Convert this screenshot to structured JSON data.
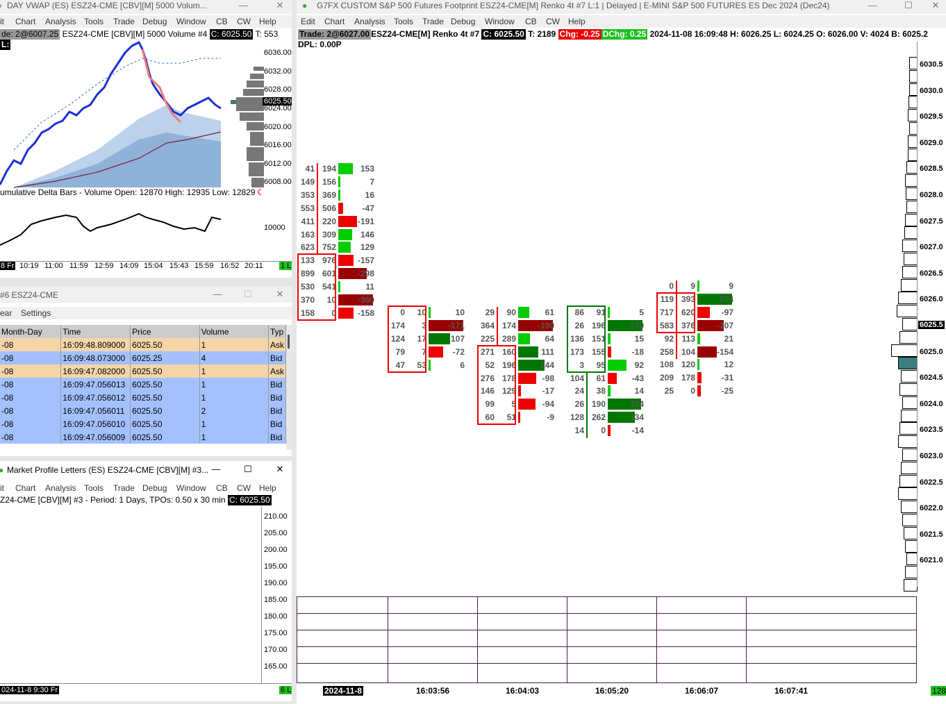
{
  "win1": {
    "title": "DAY VWAP (ES) ESZ24-CME [CBV][M]  5000 Volum...",
    "menu": [
      "it",
      "Chart",
      "Analysis",
      "Tools",
      "Trade",
      "Debug",
      "Window",
      "CB",
      "CW",
      "Help"
    ],
    "info_line1": "de: 2@6007.25",
    "info_sym": "ESZ24-CME [CBV][M]  5000 Volume #4",
    "info_close": "C: 6025.50",
    "info_t": "T: 553",
    "info_line2": "L:",
    "price_labels": [
      "6036.00",
      "6032.00",
      "6028.00",
      "6024.00",
      "6020.00",
      "6016.00",
      "6012.00",
      "6008.00"
    ],
    "price_current": "6025.50",
    "delta_title": "umulative Delta Bars - Volume  Open: 12870  High: 12935  Low: 12829",
    "delta_title_tail": "Cl",
    "delta_scale": "10000",
    "time_labels": [
      "10:19",
      "11:00",
      "11:59",
      "12:59",
      "14:09",
      "15:04",
      "15:43",
      "15:59",
      "16:52",
      "20:11"
    ],
    "time_first": "8 Fr",
    "bottom_badge": "1 L"
  },
  "win2": {
    "title": "#6 ESZ24-CME",
    "menu": [
      "ear",
      "Settings"
    ],
    "headers": [
      "Month-Day",
      "Time",
      "Price",
      "Volume",
      "Typ"
    ],
    "rows": [
      [
        "-08",
        "16:09:48.809000",
        "6025.50",
        "1",
        "Ask"
      ],
      [
        "-08",
        "16:09:48.073000",
        "6025.25",
        "4",
        "Bid"
      ],
      [
        "-08",
        "16:09:47.082000",
        "6025.50",
        "1",
        "Ask"
      ],
      [
        "-08",
        "16:09:47.056013",
        "6025.50",
        "1",
        "Bid"
      ],
      [
        "-08",
        "16:09:47.056012",
        "6025.50",
        "1",
        "Bid"
      ],
      [
        "-08",
        "16:09:47.056011",
        "6025.50",
        "2",
        "Bid"
      ],
      [
        "-08",
        "16:09:47.056010",
        "6025.50",
        "1",
        "Bid"
      ],
      [
        "-08",
        "16:09:47.056009",
        "6025.50",
        "1",
        "Bid"
      ]
    ]
  },
  "win3": {
    "title": "Market Profile Letters (ES) ESZ24-CME [CBV][M] #3...",
    "menu": [
      "it",
      "Chart",
      "Analysis",
      "Tools",
      "Trade",
      "Debug",
      "Window",
      "CB",
      "CW",
      "Help"
    ],
    "info": "Z24-CME [CBV][M] #3 - Period: 1 Days, TPOs: 0.50 x 30 min",
    "info_close": "C: 6025.50",
    "scale": [
      "210.00",
      "205.00",
      "200.00",
      "195.00",
      "190.00",
      "185.00",
      "180.00",
      "175.00",
      "170.00",
      "165.00"
    ],
    "bottom_left": "024-11-8  9:30 Fr",
    "bottom_badge": "6 L"
  },
  "win4": {
    "title": "G7FX CUSTOM S&P 500 Futures Footprint ESZ24-CME[M]  Renko 4t #7 L:1 | Delayed | E-MINI S&P 500 FUTURES ES Dec 2024 (Dec24)",
    "menu": [
      "Edit",
      "Chart",
      "Analysis",
      "Tools",
      "Trade",
      "Debug",
      "Window",
      "CB",
      "CW",
      "Help"
    ],
    "trade": "Trade: 2@6027.00",
    "sym": "ESZ24-CME[M]  Renko 4t #7",
    "close": "C: 6025.50",
    "t": "T: 2189",
    "chg": "Chg: -0.25",
    "dchg": "DChg: 0.25",
    "rest": "2024-11-08 16:09:48 H: 6026.25 L: 6024.25 O: 6026.00 V: 4024 B: 6025.2",
    "dpl": "DPL: 0.00P",
    "price_labels": [
      "6030.5",
      "6030.0",
      "6029.5",
      "6029.0",
      "6028.5",
      "6028.0",
      "6027.5",
      "6027.0",
      "6026.5",
      "6026.0",
      "6025.5",
      "6025.0",
      "6024.5",
      "6024.0",
      "6023.5",
      "6023.0",
      "6022.5",
      "6022.0",
      "6021.5",
      "6021.0"
    ],
    "current_price": "6025.5",
    "time_labels": [
      "2024-11-8",
      "16:03:56",
      "16:04:03",
      "16:05:20",
      "16:06:07",
      "16:07:41"
    ],
    "bottom_badge": "128"
  },
  "footprint": [
    {
      "bid": [
        "41",
        "149",
        "353",
        "553",
        "411",
        "163",
        "623",
        "133",
        "899",
        "530",
        "370",
        "158"
      ],
      "ask": [
        "194",
        "156",
        "369",
        "506",
        "220",
        "309",
        "752",
        "976",
        "601",
        "541",
        "10",
        "0"
      ],
      "delta": [
        "153",
        "7",
        "16",
        "-47",
        "-191",
        "146",
        "129",
        "-157",
        "-298",
        "11",
        "-360",
        "-158"
      ]
    },
    {
      "bid": [
        "0",
        "174",
        "124",
        "79",
        "47"
      ],
      "ask": [
        "10",
        "3",
        "17",
        "7",
        "53"
      ],
      "delta": [
        "10",
        "-171",
        "107",
        "-72",
        "6"
      ]
    },
    {
      "bid": [
        "29",
        "364",
        "225",
        "271",
        "52",
        "276",
        "146",
        "99",
        "60"
      ],
      "ask": [
        "90",
        "174",
        "289",
        "160",
        "196",
        "178",
        "129",
        "5",
        "51"
      ],
      "delta": [
        "61",
        "-190",
        "64",
        "111",
        "144",
        "-98",
        "-17",
        "-94",
        "-9"
      ]
    },
    {
      "bid": [
        "86",
        "26",
        "136",
        "173",
        "3",
        "104",
        "24",
        "26",
        "128",
        "14"
      ],
      "ask": [
        "91",
        "196",
        "151",
        "155",
        "95",
        "61",
        "38",
        "190",
        "262",
        "0"
      ],
      "delta": [
        "5",
        "170",
        "15",
        "-18",
        "92",
        "-43",
        "14",
        "164",
        "134",
        "-14"
      ]
    },
    {
      "bid": [
        "0",
        "119",
        "717",
        "583",
        "92",
        "258",
        "108",
        "209",
        "25"
      ],
      "ask": [
        "9",
        "393",
        "620",
        "376",
        "113",
        "104",
        "120",
        "178",
        "0"
      ],
      "delta": [
        "9",
        "274",
        "-97",
        "-207",
        "21",
        "-154",
        "12",
        "-31",
        "-25"
      ]
    }
  ],
  "colors": {
    "green": "#00cc00",
    "dark_green": "#007700",
    "red": "#ee0000",
    "dark_red": "#990000",
    "bid_row": "#a3c1ff",
    "ask_row": "#f5d5a8",
    "poc": "#3d7e7e"
  }
}
